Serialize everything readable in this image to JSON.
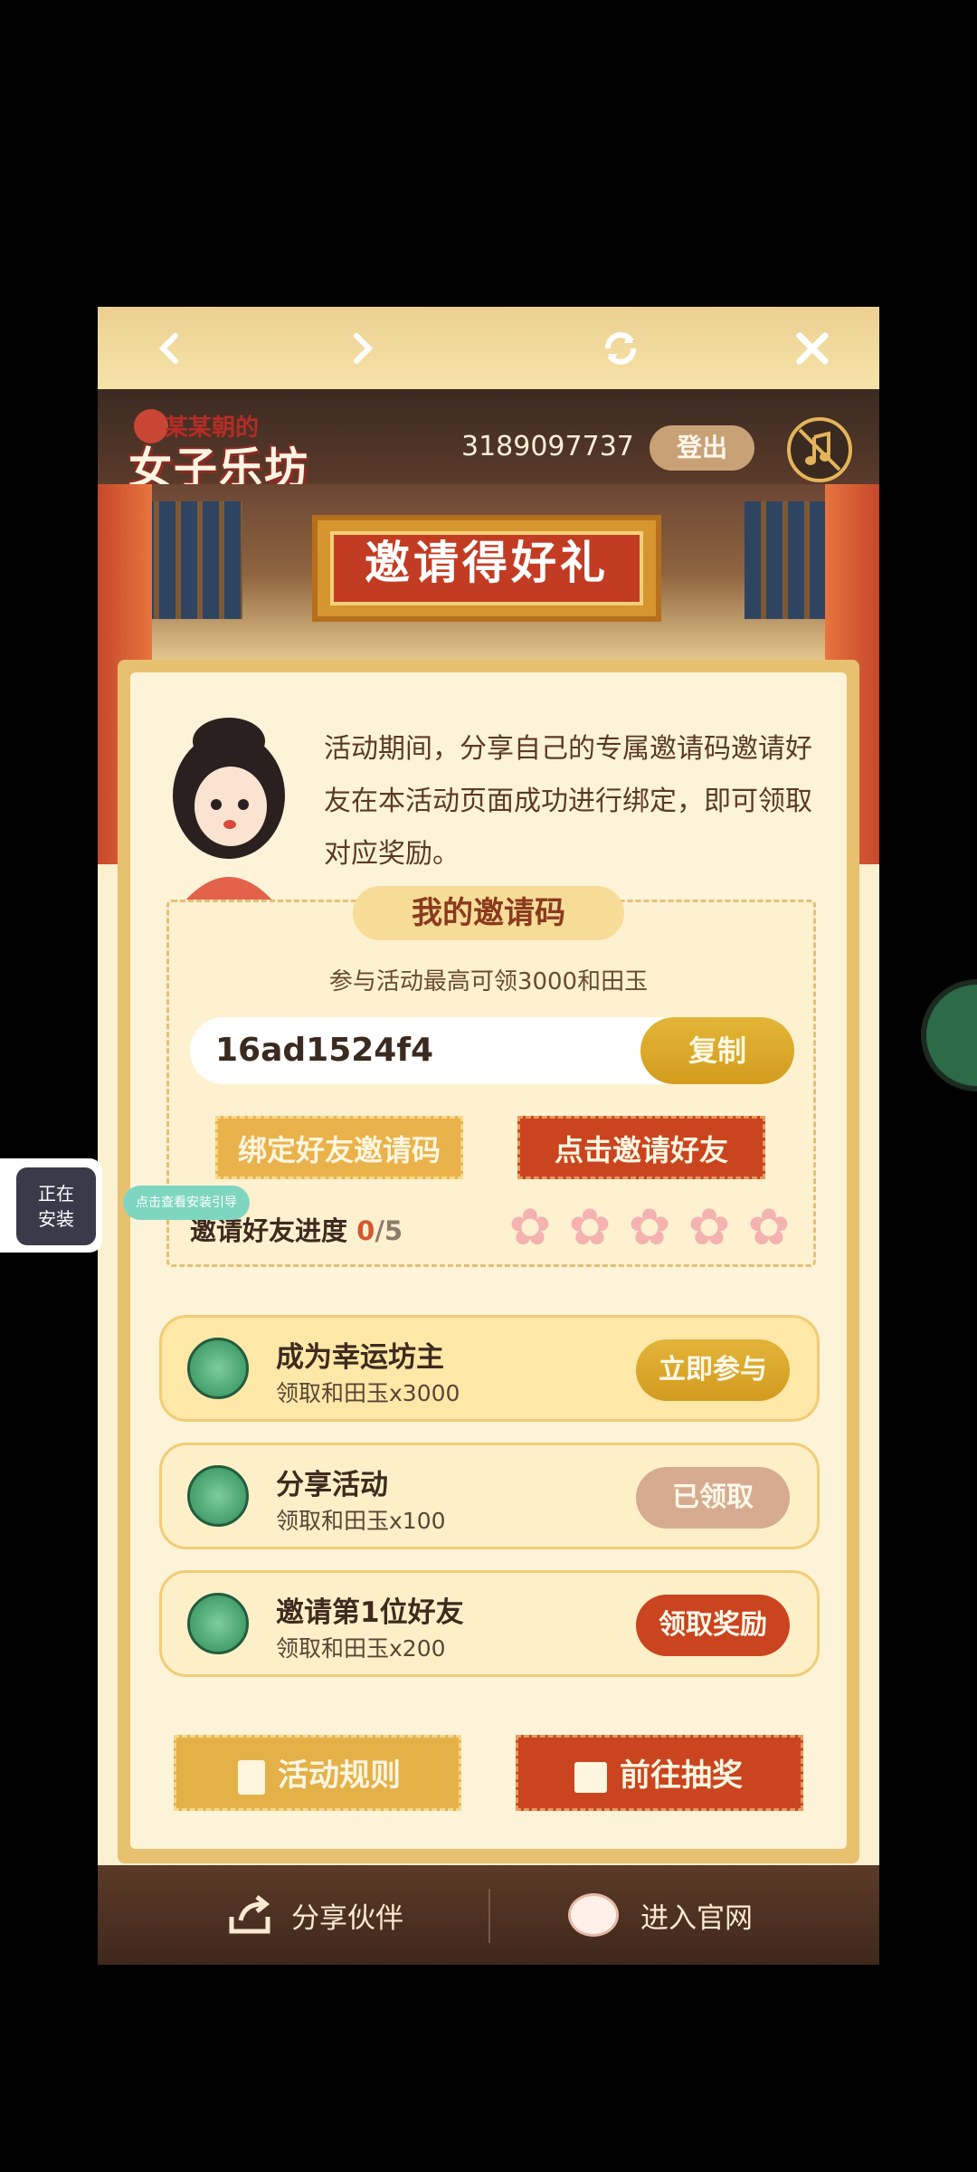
{
  "nav": {
    "back_icon": "chevron-left-icon",
    "forward_icon": "chevron-right-icon",
    "refresh_icon": "refresh-icon",
    "close_icon": "close-icon"
  },
  "header": {
    "logo_small": "某某朝的",
    "logo_large": "女子乐坊",
    "uid": "3189097737",
    "logout_label": "登出",
    "music_icon": "music-muted-icon"
  },
  "banner": {
    "title": "邀请得好礼"
  },
  "intro": {
    "text": "活动期间，分享自己的专属邀请码邀请好友在本活动页面成功进行绑定，即可领取对应奖励。"
  },
  "invite": {
    "title": "我的邀请码",
    "subtitle": "参与活动最高可领3000和田玉",
    "code": "16ad1524f4",
    "copy_label": "复制",
    "bind_label": "绑定好友邀请码",
    "invite_label": "点击邀请好友",
    "progress_label": "邀请好友进度",
    "progress_current": "0",
    "progress_total": "/5",
    "progress_value": 0,
    "progress_max": 5
  },
  "tasks": [
    {
      "title": "成为幸运坊主",
      "reward": "领取和田玉x3000",
      "button": "立即参与",
      "state": "available"
    },
    {
      "title": "分享活动",
      "reward": "领取和田玉x100",
      "button": "已领取",
      "state": "claimed"
    },
    {
      "title": "邀请第1位好友",
      "reward": "领取和田玉x200",
      "button": "领取奖励",
      "state": "claimable"
    }
  ],
  "actions": {
    "rules_label": "活动规则",
    "lottery_label": "前往抽奖"
  },
  "footer": {
    "share_label": "分享伙伴",
    "site_label": "进入官网"
  },
  "float": {
    "installing_line1": "正在",
    "installing_line2": "安装",
    "tip": "点击查看安装引导"
  },
  "colors": {
    "accent_gold": "#d39b1f",
    "accent_red": "#c9441f",
    "background": "#fbf0cf"
  }
}
